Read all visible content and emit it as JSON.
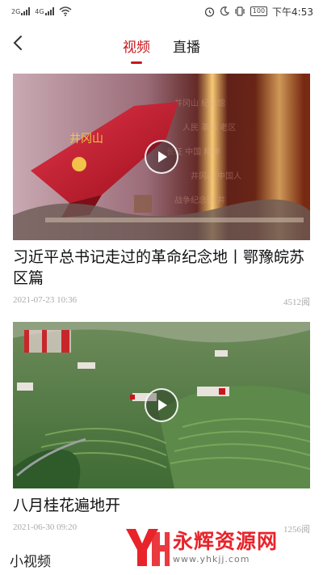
{
  "status_bar": {
    "network_1": "2G",
    "network_2": "4G",
    "battery": "100",
    "time": "下午4:53"
  },
  "tabs": [
    {
      "label": "视频",
      "active": true
    },
    {
      "label": "直播",
      "active": false
    }
  ],
  "videos": [
    {
      "title": "习近平总书记走过的革命纪念地丨鄂豫皖苏区篇",
      "date": "2021-07-23 10:36",
      "views": "4512阅"
    },
    {
      "title": "八月桂花遍地开",
      "date": "2021-06-30 09:20",
      "views": "1256阅"
    }
  ],
  "section": {
    "title": "小视频"
  },
  "watermark": {
    "name": "永辉资源网",
    "url": "www.yhkjj.com"
  },
  "colors": {
    "accent": "#c8161d",
    "watermark": "#e8232a"
  },
  "icons": [
    "back-arrow-icon",
    "play-icon",
    "wifi-icon",
    "alarm-icon",
    "moon-icon",
    "vibrate-icon"
  ]
}
